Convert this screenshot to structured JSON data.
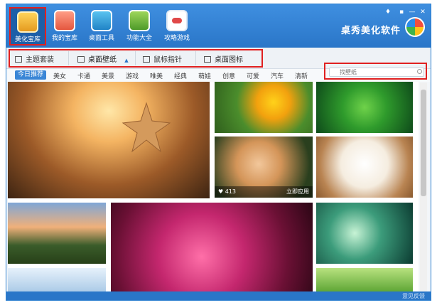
{
  "nav": {
    "items": [
      {
        "label": "美化宝库"
      },
      {
        "label": "我的宝库"
      },
      {
        "label": "桌面工具"
      },
      {
        "label": "功能大全"
      },
      {
        "label": "攻略游戏"
      }
    ]
  },
  "brand": {
    "title": "桌秀美化软件"
  },
  "window_controls": {
    "skin": "♦",
    "menu": "▪",
    "minimize": "—",
    "close": "✕"
  },
  "subtabs": {
    "items": [
      {
        "label": "主题套装",
        "icon": "theme-icon"
      },
      {
        "label": "桌面壁纸",
        "icon": "wallpaper-icon"
      },
      {
        "label": "鼠标指针",
        "icon": "cursor-icon"
      },
      {
        "label": "桌面图标",
        "icon": "monitor-icon"
      }
    ]
  },
  "categories": {
    "items": [
      "今日推荐",
      "美女",
      "卡通",
      "美景",
      "游戏",
      "唯美",
      "经典",
      "萌娃",
      "创意",
      "可爱",
      "汽车",
      "清新"
    ]
  },
  "search": {
    "placeholder": "找壁纸"
  },
  "tiles": {
    "kitten": {
      "likes": "413",
      "apply": "立即应用"
    }
  },
  "footer": {
    "feedback": "意见反馈"
  },
  "colors": {
    "header_blue": "#2a76c8",
    "highlight_red": "#e02020",
    "active_blue": "#3a86d6"
  }
}
